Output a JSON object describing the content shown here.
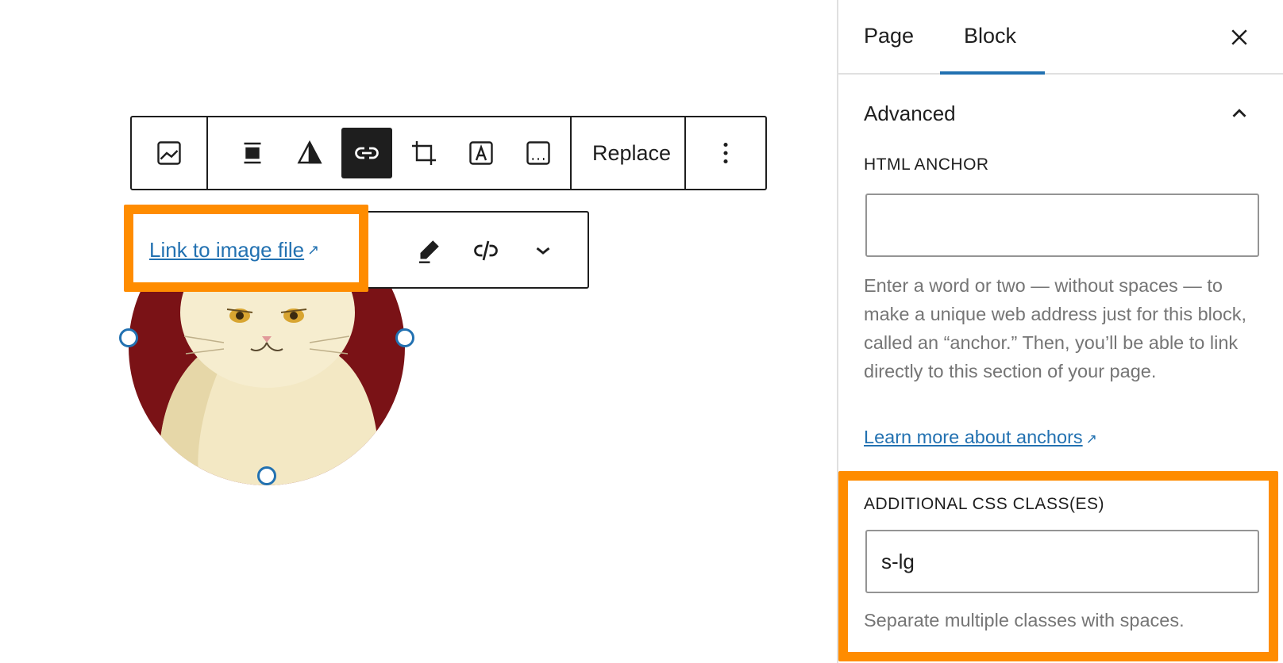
{
  "toolbar": {
    "replace_label": "Replace"
  },
  "link_popover": {
    "link_text": "Link to image file",
    "external_glyph": "↗"
  },
  "sidebar": {
    "tabs": [
      {
        "label": "Page"
      },
      {
        "label": "Block"
      }
    ],
    "active_tab": "Block",
    "section_title": "Advanced",
    "html_anchor": {
      "label": "HTML ANCHOR",
      "value": "",
      "help": "Enter a word or two — without spaces — to make a unique web address just for this block, called an “anchor.” Then, you’ll be able to link directly to this section of your page.",
      "learn_more": "Learn more about anchors"
    },
    "css_classes": {
      "label": "ADDITIONAL CSS CLASS(ES)",
      "value": "s-lg",
      "help": "Separate multiple classes with spaces."
    }
  },
  "colors": {
    "accent": "#2271b1",
    "highlight": "#ff8c00",
    "image_background": "#7a1216",
    "dark": "#1e1e1e"
  }
}
